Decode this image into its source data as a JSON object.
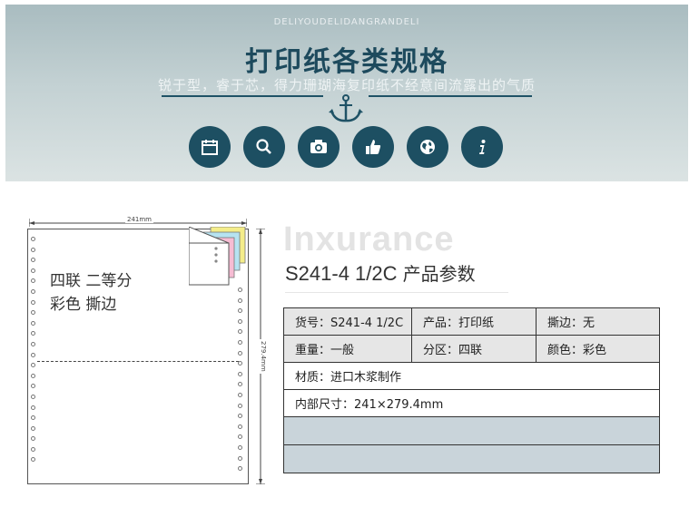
{
  "banner": {
    "en_heading": "DELIYOUDELIDANGRANDELI",
    "title": "打印纸各类规格",
    "subtitle": "锐于型，睿于芯，得力珊瑚海复印纸不经意间流露出的气质",
    "icons": [
      "calendar-icon",
      "search-icon",
      "camera-icon",
      "thumbs-up-icon",
      "globe-icon",
      "info-icon"
    ],
    "colors": {
      "accent": "#1d4f62"
    }
  },
  "paper": {
    "width_label": "241mm",
    "height_label": "279.4mm",
    "text_line1": "四联  二等分",
    "text_line2": "彩色  撕边"
  },
  "product": {
    "watermark": "Inxurance",
    "model": "S241-4 1/2C",
    "title_suffix": "产品参数"
  },
  "spec": {
    "row1": [
      "货号：S241-4 1/2C",
      "产品：打印纸",
      "撕边：无"
    ],
    "row2": [
      "重量：一般",
      "分区：四联",
      "颜色：彩色"
    ],
    "row3": "材质：进口木浆制作",
    "row4": "内部尺寸：241×279.4mm"
  }
}
